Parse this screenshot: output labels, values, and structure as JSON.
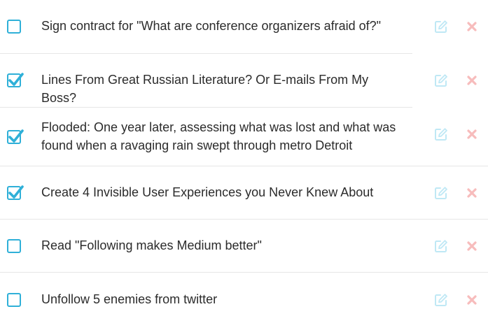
{
  "colors": {
    "accent": "#2fb0d8",
    "edit_icon": "#bfe8f5",
    "delete_icon": "#f7bcbc",
    "divider": "#e6e6e6",
    "text": "#2b2b2b"
  },
  "todos": [
    {
      "label": "Sign contract for \"What are conference organizers afraid of?\"",
      "checked": false
    },
    {
      "label": "Lines From Great Russian Literature? Or E-mails From My Boss?",
      "checked": true
    },
    {
      "label": "Flooded: One year later, assessing what was lost and what was found when a ravaging rain swept through metro Detroit",
      "checked": true
    },
    {
      "label": "Create 4 Invisible User Experiences you Never Knew About",
      "checked": true
    },
    {
      "label": "Read \"Following makes Medium better\"",
      "checked": false
    },
    {
      "label": "Unfollow 5 enemies from twitter",
      "checked": false
    }
  ],
  "icons": {
    "edit": "edit-icon",
    "delete": "close-icon",
    "check": "check-icon"
  }
}
